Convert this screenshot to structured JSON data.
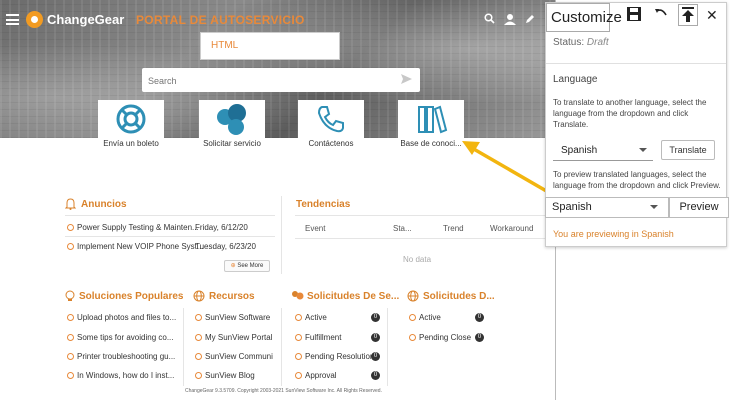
{
  "portal": {
    "brand": "ChangeGear",
    "title": "PORTAL DE AUTOSERVICIO",
    "html_label": "HTML",
    "search_placeholder": "Search",
    "tiles": [
      {
        "label": "Envía un boleto",
        "icon": "lifebuoy-icon"
      },
      {
        "label": "Solicitar servicio",
        "icon": "bubbles-icon"
      },
      {
        "label": "Contáctenos",
        "icon": "phone-icon"
      },
      {
        "label": "Base de conoci...",
        "icon": "books-icon"
      }
    ],
    "announcements": {
      "title": "Anuncios",
      "items": [
        {
          "text": "Power Supply Testing & Mainten...",
          "date": "Friday, 6/12/20"
        },
        {
          "text": "Implement New VOIP Phone Syst...",
          "date": "Tuesday, 6/23/20"
        }
      ],
      "see_more": "See More"
    },
    "trends": {
      "title": "Tendencias",
      "columns": [
        "Event",
        "Sta...",
        "Trend",
        "Workaround"
      ],
      "empty": "No data"
    },
    "popular": {
      "title": "Soluciones Populares",
      "items": [
        "Upload photos and files to...",
        "Some tips for avoiding co...",
        "Printer troubleshooting gu...",
        "In Windows, how do I inst..."
      ]
    },
    "resources": {
      "title": "Recursos",
      "items": [
        "SunView Software",
        "My SunView Portal",
        "SunView Communi",
        "SunView Blog"
      ]
    },
    "requests": {
      "title": "Solicitudes De Se...",
      "items": [
        {
          "label": "Active",
          "count": "0"
        },
        {
          "label": "Fulfillment",
          "count": "0"
        },
        {
          "label": "Pending Resolution",
          "count": "0"
        },
        {
          "label": "Approval",
          "count": "0"
        }
      ]
    },
    "requests2": {
      "title": "Solicitudes D...",
      "items": [
        {
          "label": "Active",
          "count": "0"
        },
        {
          "label": "Pending Close",
          "count": "0"
        }
      ]
    },
    "footer": "ChangeGear 9.3.5709. Copyright 2003-2021 SunView Software Inc. All Rights Reserved."
  },
  "customize": {
    "title": "Customize",
    "status_label": "Status:",
    "status_value": "Draft",
    "language_heading": "Language",
    "translate_help": "To translate to another language, select the language from the dropdown and click Translate.",
    "translate_select": "Spanish",
    "translate_button": "Translate",
    "preview_help": "To preview translated languages, select the language from the dropdown and click Preview.",
    "preview_select": "Spanish",
    "preview_button": "Preview",
    "preview_notice": "You are previewing in Spanish"
  },
  "colors": {
    "accent": "#d9822b",
    "arrow": "#f2b50f",
    "tile_blue": "#2e8fb5"
  }
}
